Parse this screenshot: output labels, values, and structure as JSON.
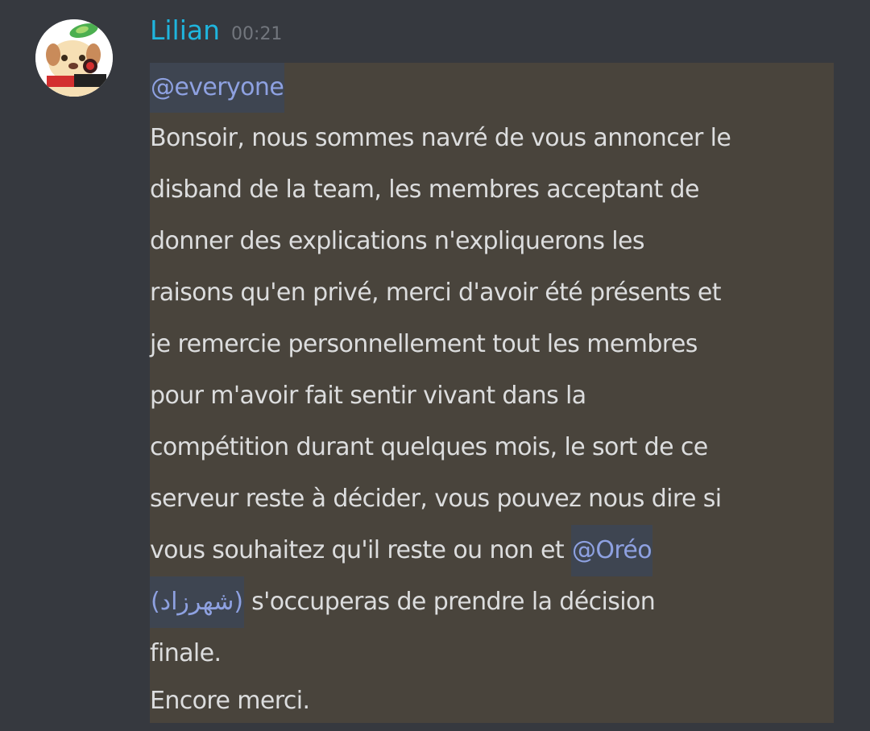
{
  "message": {
    "author": "Lilian",
    "time": "00:21",
    "mention_everyone": "@everyone",
    "lines": [
      "Bonsoir, nous sommes navré de vous annoncer le",
      "disband de la team, les membres acceptant de",
      "donner des explications n'expliquerons les",
      "raisons qu'en privé, merci d'avoir été présents et",
      "je remercie personnellement tout les membres",
      "pour m'avoir fait sentir vivant dans la",
      "compétition durant quelques mois, le sort de ce",
      "serveur reste à décider, vous pouvez nous dire si"
    ],
    "line9_text": "vous souhaitez qu'il reste ou non et ",
    "mention_user_part1": "@Oréo",
    "mention_user_part2": "(شهرزاد)",
    "line10_text": " s'occuperas de prendre la décision",
    "line11": "finale.",
    "line12": "Encore merci."
  },
  "colors": {
    "background": "#36393f",
    "highlight": "#49443c",
    "username": "#1fb5de",
    "mention_text": "#8ea1e1",
    "mention_bg": "#3e4551",
    "text": "#dcddde"
  }
}
